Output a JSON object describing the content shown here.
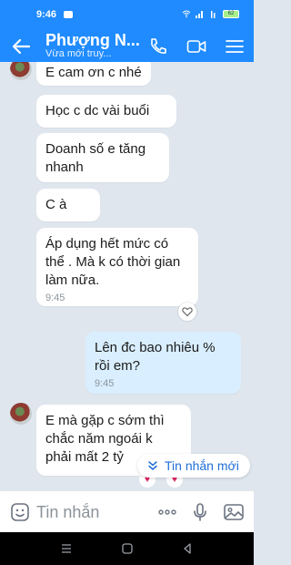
{
  "status_bar": {
    "time": "9:46",
    "battery": "62"
  },
  "header": {
    "contact_name": "Phượng N...",
    "status": "Vừa mới truy..."
  },
  "messages": [
    {
      "text": "E cam ơn c nhé"
    },
    {
      "text": "Học c dc vài buổi"
    },
    {
      "text": "Doanh số e tăng nhanh"
    },
    {
      "text": "C à"
    },
    {
      "text": "Áp dụng hết mức có thể . Mà k có thời gian làm nữa.",
      "time": "9:45"
    },
    {
      "text": "Lên đc bao nhiêu % rồi em?",
      "time": "9:45"
    },
    {
      "text": "E mà gặp c sớm thì chắc năm ngoái k phải mất 2 tỷ"
    }
  ],
  "new_messages_label": "Tin nhắn mới",
  "input": {
    "placeholder": "Tin nhắn"
  },
  "colors": {
    "accent": "#1f8bff",
    "outgoing_bubble": "#d9eefe",
    "chat_background": "#dfe6ee"
  },
  "icons": [
    "back-arrow-icon",
    "phone-icon",
    "video-call-icon",
    "menu-icon",
    "sticker-icon",
    "more-icon",
    "microphone-icon",
    "image-icon",
    "heart-icon",
    "chevron-down-icon"
  ]
}
